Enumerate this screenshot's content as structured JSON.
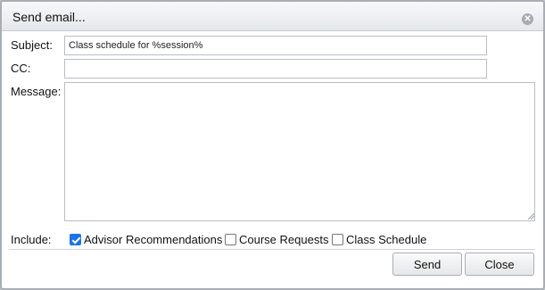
{
  "dialog": {
    "title": "Send email...",
    "close_icon": "close-icon"
  },
  "form": {
    "subject_label": "Subject:",
    "subject_value": "Class schedule for %session%",
    "cc_label": "CC:",
    "cc_value": "",
    "message_label": "Message:",
    "message_value": "",
    "include_label": "Include:",
    "options": [
      {
        "label": "Advisor Recommendations",
        "checked": true
      },
      {
        "label": "Course Requests",
        "checked": false
      },
      {
        "label": "Class Schedule",
        "checked": false
      }
    ]
  },
  "buttons": {
    "send": "Send",
    "close": "Close"
  },
  "colors": {
    "checkbox_accent": "#1a73e8",
    "title_bar": "#eceef1",
    "border": "#a9aeb5"
  }
}
